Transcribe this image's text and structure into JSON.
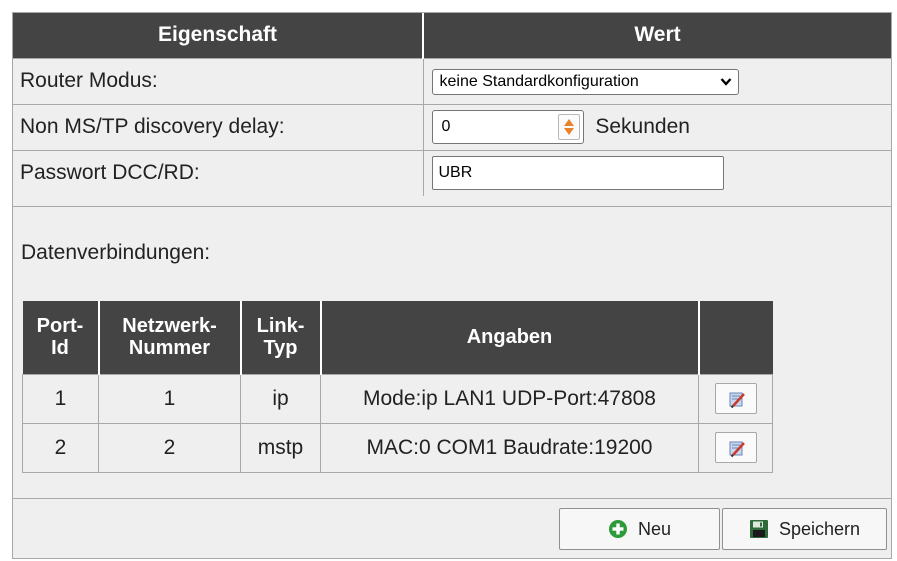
{
  "header": {
    "col_property": "Eigenschaft",
    "col_value": "Wert"
  },
  "properties": {
    "router_mode": {
      "label": "Router Modus:",
      "selected": "keine Standardkonfiguration"
    },
    "discovery_delay": {
      "label": "Non MS/TP discovery delay:",
      "value": "0",
      "unit": "Sekunden"
    },
    "password": {
      "label": "Passwort DCC/RD:",
      "value": "UBR"
    }
  },
  "connections": {
    "label": "Datenverbindungen:",
    "headers": {
      "port_id": "Port-\nId",
      "network": "Netzwerk-\nNummer",
      "link_type": "Link-\nTyp",
      "details": "Angaben"
    },
    "rows": [
      {
        "port": "1",
        "network": "1",
        "link": "ip",
        "details": "Mode:ip LAN1 UDP-Port:47808"
      },
      {
        "port": "2",
        "network": "2",
        "link": "mstp",
        "details": "MAC:0 COM1 Baudrate:19200"
      }
    ]
  },
  "footer": {
    "new_label": "Neu",
    "save_label": "Speichern"
  },
  "colors": {
    "header_bg": "#444444",
    "body_bg": "#efefef",
    "spinner_accent": "#e8832a",
    "add_icon": "#2e9b3a",
    "save_icon": "#2f6b3a"
  },
  "icons": {
    "spinner": "spinner-arrows-icon",
    "edit": "edit-pencil-icon",
    "new": "plus-circle-icon",
    "save": "floppy-disk-icon"
  }
}
